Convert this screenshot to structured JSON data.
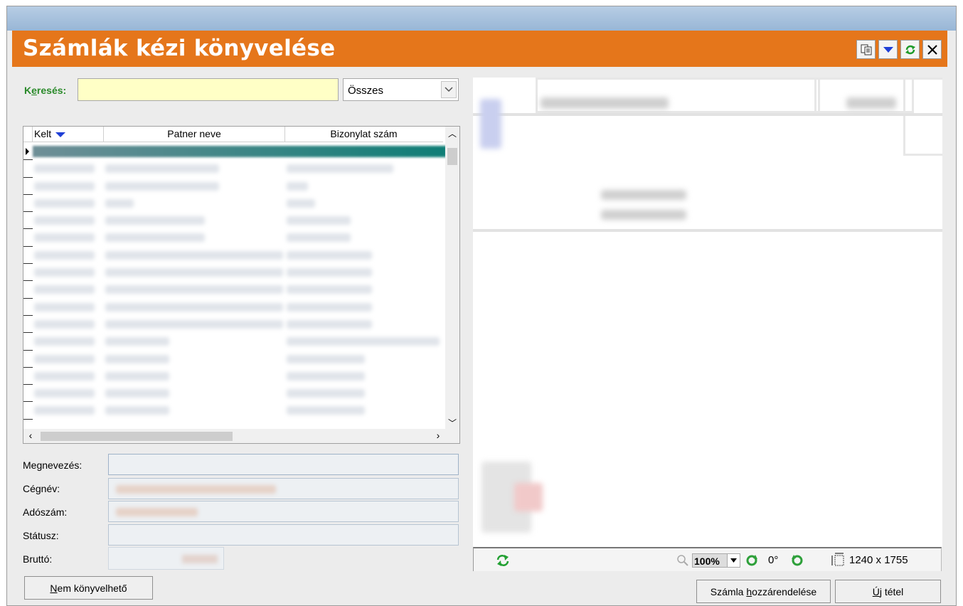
{
  "window": {
    "title": "Számlák kézi könyvelése"
  },
  "title_buttons": [
    {
      "name": "copy",
      "icon": "copy-icon"
    },
    {
      "name": "dropdown",
      "icon": "triangle-down-icon"
    },
    {
      "name": "refresh",
      "icon": "refresh-icon"
    },
    {
      "name": "close",
      "icon": "close-icon"
    }
  ],
  "search": {
    "label_prefix": "K",
    "label_underlined": "e",
    "label_rest": "resés:",
    "value": "",
    "filter_selected": "Összes"
  },
  "grid": {
    "columns": [
      "Kelt",
      "Patner neve",
      "Bizonylat szám"
    ],
    "row_count": 16,
    "selected_row": 0
  },
  "form": {
    "megnevezes_label": "Megnevezés:",
    "cegnev_label": "Cégnév:",
    "adoszam_label": "Adószám:",
    "statusz_label": "Státusz:",
    "brutto_label": "Bruttó:"
  },
  "buttons": {
    "nem_konyvelheto_u": "N",
    "nem_konyvelheto_rest": "em könyvelhető",
    "szamla_pre": "Számla ",
    "szamla_u": "h",
    "szamla_rest": "ozzárendelése",
    "uj_tetel_u": "Ú",
    "uj_tetel_rest": "j tétel"
  },
  "viewer": {
    "zoom": "100%",
    "rotation": "0°",
    "dimensions": "1240 x 1755"
  },
  "colors": {
    "title_bar": "#e5761b",
    "search_label": "#2a8a2a",
    "search_bg": "#ffffc6",
    "selected_row": "#0e7e76"
  }
}
